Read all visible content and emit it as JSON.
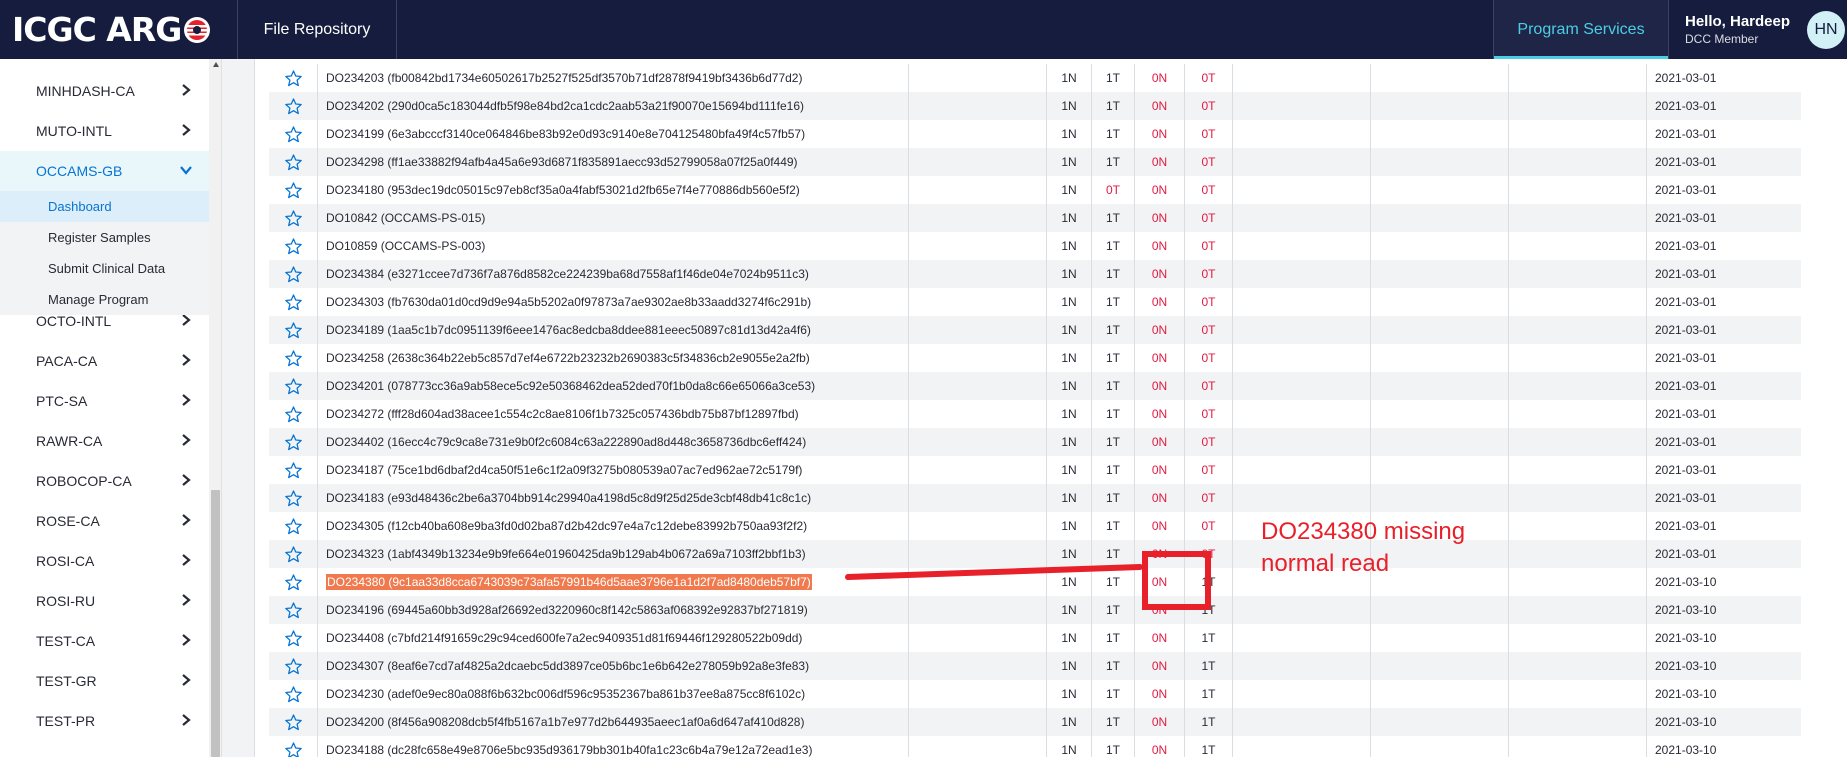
{
  "header": {
    "logo_text": "ICGC ARG",
    "nav_repo": "File Repository",
    "nav_services": "Program Services",
    "user_name": "Hello, Hardeep",
    "user_role": "DCC Member",
    "avatar_initials": "HN",
    "colors": {
      "bg": "#151c3d",
      "accent": "#4bcee5"
    }
  },
  "sidebar": {
    "programs": [
      "MINHDASH-CA",
      "MUTO-INTL",
      "OCCAMS-GB",
      "OCTO-INTL",
      "PACA-CA",
      "PTC-SA",
      "RAWR-CA",
      "ROBOCOP-CA",
      "ROSE-CA",
      "ROSI-CA",
      "ROSI-RU",
      "TEST-CA",
      "TEST-GR",
      "TEST-PR"
    ],
    "expanded_program": "OCCAMS-GB",
    "subitems": [
      "Dashboard",
      "Register Samples",
      "Submit Clinical Data",
      "Manage Program"
    ],
    "active_subitem": "Dashboard"
  },
  "table": {
    "rows": [
      {
        "id": "DO234203 (fb00842bd1734e60502617b2527f525df3570b71df2878f9419bf3436b6d77d2)",
        "n1": "1N",
        "t1": "1T",
        "n2": "0N",
        "t2": "0T",
        "date": "2021-03-01"
      },
      {
        "id": "DO234202 (290d0ca5c183044dfb5f98e84bd2ca1cdc2aab53a21f90070e15694bd111fe16)",
        "n1": "1N",
        "t1": "1T",
        "n2": "0N",
        "t2": "0T",
        "date": "2021-03-01"
      },
      {
        "id": "DO234199 (6e3abcccf3140ce064846be83b92e0d93c9140e8e704125480bfa49f4c57fb57)",
        "n1": "1N",
        "t1": "1T",
        "n2": "0N",
        "t2": "0T",
        "date": "2021-03-01"
      },
      {
        "id": "DO234298 (ff1ae33882f94afb4a45a6e93d6871f835891aecc93d52799058a07f25a0f449)",
        "n1": "1N",
        "t1": "1T",
        "n2": "0N",
        "t2": "0T",
        "date": "2021-03-01"
      },
      {
        "id": "DO234180 (953dec19dc05015c97eb8cf35a0a4fabf53021d2fb65e7f4e770886db560e5f2)",
        "n1": "1N",
        "t1": "0T",
        "n2": "0N",
        "t2": "0T",
        "date": "2021-03-01"
      },
      {
        "id": "DO10842 (OCCAMS-PS-015)",
        "n1": "1N",
        "t1": "1T",
        "n2": "0N",
        "t2": "0T",
        "date": "2021-03-01"
      },
      {
        "id": "DO10859 (OCCAMS-PS-003)",
        "n1": "1N",
        "t1": "1T",
        "n2": "0N",
        "t2": "0T",
        "date": "2021-03-01"
      },
      {
        "id": "DO234384 (e3271ccee7d736f7a876d8582ce224239ba68d7558af1f46de04e7024b9511c3)",
        "n1": "1N",
        "t1": "1T",
        "n2": "0N",
        "t2": "0T",
        "date": "2021-03-01"
      },
      {
        "id": "DO234303 (fb7630da01d0cd9d9e94a5b5202a0f97873a7ae9302ae8b33aadd3274f6c291b)",
        "n1": "1N",
        "t1": "1T",
        "n2": "0N",
        "t2": "0T",
        "date": "2021-03-01"
      },
      {
        "id": "DO234189 (1aa5c1b7dc0951139f6eee1476ac8edcba8ddee881eeec50897c81d13d42a4f6)",
        "n1": "1N",
        "t1": "1T",
        "n2": "0N",
        "t2": "0T",
        "date": "2021-03-01"
      },
      {
        "id": "DO234258 (2638c364b22eb5c857d7ef4e6722b23232b2690383c5f34836cb2e9055e2a2fb)",
        "n1": "1N",
        "t1": "1T",
        "n2": "0N",
        "t2": "0T",
        "date": "2021-03-01"
      },
      {
        "id": "DO234201 (078773cc36a9ab58ece5c92e50368462dea52ded70f1b0da8c66e65066a3ce53)",
        "n1": "1N",
        "t1": "1T",
        "n2": "0N",
        "t2": "0T",
        "date": "2021-03-01"
      },
      {
        "id": "DO234272 (fff28d604ad38acee1c554c2c8ae8106f1b7325c057436bdb75b87bf12897fbd)",
        "n1": "1N",
        "t1": "1T",
        "n2": "0N",
        "t2": "0T",
        "date": "2021-03-01"
      },
      {
        "id": "DO234402 (16ecc4c79c9ca8e731e9b0f2c6084c63a222890ad8d448c3658736dbc6eff424)",
        "n1": "1N",
        "t1": "1T",
        "n2": "0N",
        "t2": "0T",
        "date": "2021-03-01"
      },
      {
        "id": "DO234187 (75ce1bd6dbaf2d4ca50f51e6c1f2a09f3275b080539a07ac7ed962ae72c5179f)",
        "n1": "1N",
        "t1": "1T",
        "n2": "0N",
        "t2": "0T",
        "date": "2021-03-01"
      },
      {
        "id": "DO234183 (e93d48436c2be6a3704bb914c29940a4198d5c8d9f25d25de3cbf48db41c8c1c)",
        "n1": "1N",
        "t1": "1T",
        "n2": "0N",
        "t2": "0T",
        "date": "2021-03-01"
      },
      {
        "id": "DO234305 (f12cb40ba608e9ba3fd0d02ba87d2b42dc97e4a7c12debe83992b750aa93f2f2)",
        "n1": "1N",
        "t1": "1T",
        "n2": "0N",
        "t2": "0T",
        "date": "2021-03-01"
      },
      {
        "id": "DO234323 (1abf4349b13234e9b9fe664e01960425da9b129ab4b0672a69a7103ff2bbf1b3)",
        "n1": "1N",
        "t1": "1T",
        "n2": "0N",
        "t2": "0T",
        "date": "2021-03-01"
      },
      {
        "id": "DO234380 (9c1aa33d8cca6743039c73afa57991b46d5aae3796e1a1d2f7ad8480deb57bf7)",
        "n1": "1N",
        "t1": "1T",
        "n2": "0N",
        "t2": "1T",
        "date": "2021-03-10",
        "highlighted": true
      },
      {
        "id": "DO234196 (69445a60bb3d928af26692ed3220960c8f142c5863af068392e92837bf271819)",
        "n1": "1N",
        "t1": "1T",
        "n2": "0N",
        "t2": "1T",
        "date": "2021-03-10"
      },
      {
        "id": "DO234408 (c7bfd214f91659c29c94ced600fe7a2ec9409351d81f69446f129280522b09dd)",
        "n1": "1N",
        "t1": "1T",
        "n2": "0N",
        "t2": "1T",
        "date": "2021-03-10"
      },
      {
        "id": "DO234307 (8eaf6e7cd7af4825a2dcaebc5dd3897ce05b6bc1e6b642e278059b92a8e3fe83)",
        "n1": "1N",
        "t1": "1T",
        "n2": "0N",
        "t2": "1T",
        "date": "2021-03-10"
      },
      {
        "id": "DO234230 (adef0e9ec80a088f6b632bc006df596c95352367ba861b37ee8a875cc8f6102c)",
        "n1": "1N",
        "t1": "1T",
        "n2": "0N",
        "t2": "1T",
        "date": "2021-03-10"
      },
      {
        "id": "DO234200 (8f456a908208dcb5f4fb5167a1b7e977d2b644935aeec1af0a6d647af410d828)",
        "n1": "1N",
        "t1": "1T",
        "n2": "0N",
        "t2": "1T",
        "date": "2021-03-10"
      },
      {
        "id": "DO234188 (dc28fc658e49e8706e5bc935d936179bb301b40fa1c23c6b4a79e12a72ead1e3)",
        "n1": "1N",
        "t1": "1T",
        "n2": "0N",
        "t2": "1T",
        "date": "2021-03-10"
      }
    ]
  },
  "annotation": {
    "line1": "DO234380 missing",
    "line2": "normal read",
    "color": "#e8202a"
  }
}
